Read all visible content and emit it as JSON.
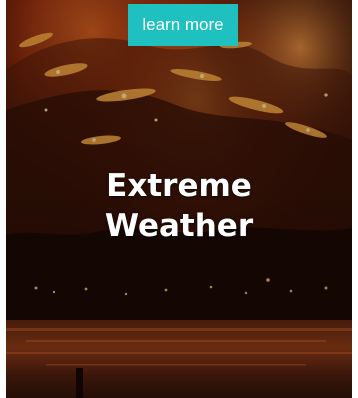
{
  "card": {
    "button_label": "learn more",
    "headline_line1": "Extreme",
    "headline_line2": "Weather",
    "background_image": "wildfire-hillside-at-night-over-lake"
  },
  "colors": {
    "button_bg": "#1fc1c0",
    "button_text": "#ffffff",
    "headline_text": "#ffffff",
    "fire_glow": "#e6531a"
  }
}
